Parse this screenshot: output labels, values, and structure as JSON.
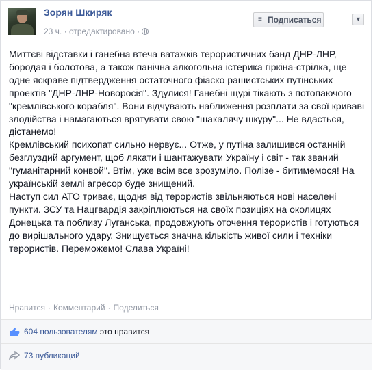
{
  "post": {
    "author": "Зорян Шкиряк",
    "time": "23 ч.",
    "separator": "·",
    "edited": "отредактировано",
    "paragraphs": [
      "Миттєві відставки і ганебна втеча ватажків терористичних банд ДНР-ЛНР, бородая і болотова, а також панічна алкогольна істерика гіркіна-стрілка, ще одне яскраве підтвердження остаточного фіаско рашистських путінських проектів \"ДНР-ЛНР-Новоросія\". Здулися! Ганебні щурі тікають з потопаючого \"кремлівського корабля\". Вони відчувають наближення розплати за свої криваві злодійства і намагаються врятувати свою \"шакалячу шкуру\"... Не вдасться, дістанемо!",
      "Кремлівський психопат сильно нервує... Отже, у путіна залишився останній безглуздий аргумент, щоб лякати і шантажувати Україну і світ - так званий \"гуманітарний конвой\". Втім, уже всім все зрозуміло. Полізе - битимемося! На українській землі агресор буде знищений.",
      "Наступ сил АТО триває, щодня від терористів звільняються нові населені пункти. ЗСУ та Нацгвардія закріплюються на своїх позиціях на околицях Донецька та поблизу Луганська, продовжують оточення терористів і готуються до вирішального удару. Знищується значна кількість живої сили і техніки терористів. Переможемо! Слава Україні!"
    ]
  },
  "subscribe": {
    "label": "Подписаться",
    "icon": "rss-icon"
  },
  "actions": {
    "like": "Нравится",
    "comment": "Комментарий",
    "share": "Поделиться",
    "dot": "·"
  },
  "feedback": {
    "likes_count": "604 пользователям",
    "likes_suffix": "это нравится",
    "shares": "73 публикаций"
  },
  "colors": {
    "link": "#3b5998",
    "meta": "#9197a3",
    "text": "#141823"
  }
}
